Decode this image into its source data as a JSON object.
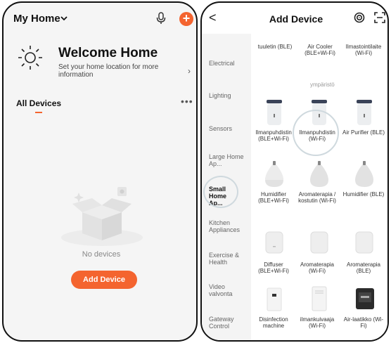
{
  "left": {
    "home_title": "My Home",
    "welcome_title": "Welcome Home",
    "welcome_sub": "Set your home location for more information",
    "all_devices": "All Devices",
    "no_devices": "No devices",
    "add_device": "Add Device"
  },
  "right": {
    "title": "Add Device",
    "categories": [
      "Electrical",
      "Lighting",
      "Sensors",
      "Large Home Ap...",
      "Small Home Ap...",
      "Kitchen Appliances",
      "Exercise & Health",
      "Video valvonta",
      "Gateway Control"
    ],
    "selected_category": "Small Home Ap...",
    "section_label": "ympäristö",
    "devices": [
      "tuuletin (BLE)",
      "Air Cooler (BLE+Wi-Fi)",
      "Ilmastointilaite (Wi-Fi)",
      "Ilmanpuhdistin (BLE+Wi-Fi)",
      "Ilmanpuhdistin (Wi-Fi)",
      "Air Purifier (BLE)",
      "Humidifier (BLE+Wi-Fi)",
      "Aromaterapia / kostutin (Wi-Fi)",
      "Humidifier (BLE)",
      "Diffuser (BLE+Wi-Fi)",
      "Aromaterapia (Wi-Fi)",
      "Aromaterapia (BLE)",
      "Disinfection machine",
      "ilmankuivaaja (Wi-Fi)",
      "Air-laatikko (Wi-Fi)"
    ]
  },
  "colors": {
    "accent": "#f4642f",
    "highlight_ring": "#cfd9de"
  },
  "icons": [
    "chevron-down-icon",
    "mic-icon",
    "plus-icon",
    "sun-icon",
    "more-icon",
    "back-icon",
    "scan-icon",
    "fullscreen-scan-icon"
  ]
}
